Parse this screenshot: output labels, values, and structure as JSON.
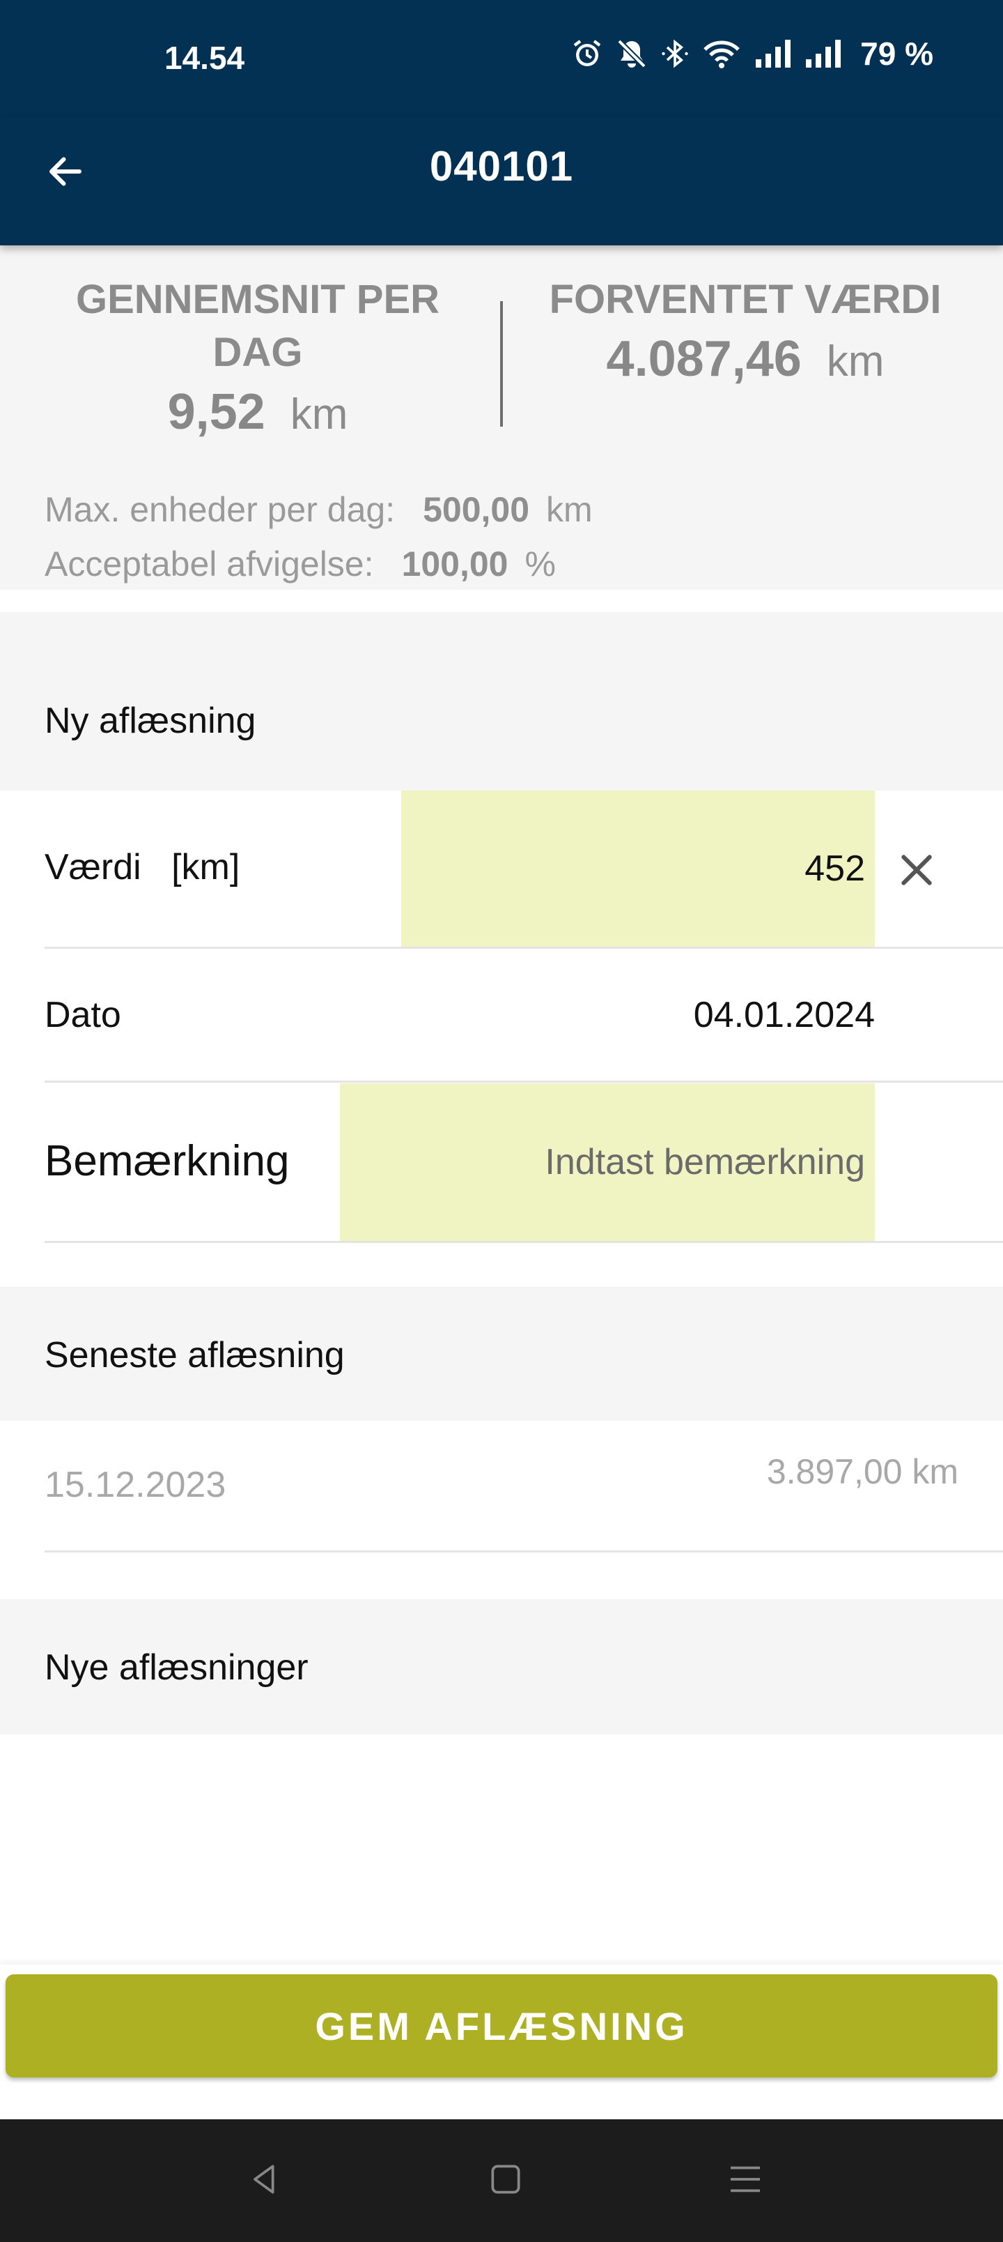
{
  "status_bar": {
    "time": "14.54",
    "battery": "79 %",
    "icons": [
      "alarm-icon",
      "bell-muted-icon",
      "bluetooth-icon",
      "wifi-icon",
      "signal-icon",
      "signal-icon"
    ]
  },
  "app_bar": {
    "title": "040101",
    "back_icon": "arrow-left-icon"
  },
  "stats": {
    "avg_label": "GENNEMSNIT PER DAG",
    "avg_value": "9,52",
    "avg_unit": "km",
    "expected_label": "FORVENTET VÆRDI",
    "expected_value": "4.087,46",
    "expected_unit": "km",
    "max_label": "Max. enheder per dag:",
    "max_value": "500,00",
    "max_unit": "km",
    "dev_label": "Acceptabel afvigelse:",
    "dev_value": "100,00",
    "dev_unit": "%"
  },
  "new_reading": {
    "section_title": "Ny aflæsning",
    "value_label": "Værdi",
    "value_unit": "[km]",
    "value": "452",
    "clear_icon": "close-icon",
    "date_label": "Dato",
    "date_value": "04.01.2024",
    "remark_label": "Bemærkning",
    "remark_placeholder": "Indtast bemærkning"
  },
  "latest_reading": {
    "section_title": "Seneste aflæsning",
    "date": "15.12.2023",
    "value": "3.897,00 km"
  },
  "new_readings": {
    "section_title": "Nye aflæsninger"
  },
  "save_button": {
    "label": "GEM AFLÆSNING",
    "color": "#aeb023"
  },
  "colors": {
    "header": "#023154",
    "input_highlight": "#eff4c2"
  },
  "nav_bar": {
    "icons": [
      "back-triangle-icon",
      "home-square-icon",
      "menu-lines-icon"
    ]
  }
}
